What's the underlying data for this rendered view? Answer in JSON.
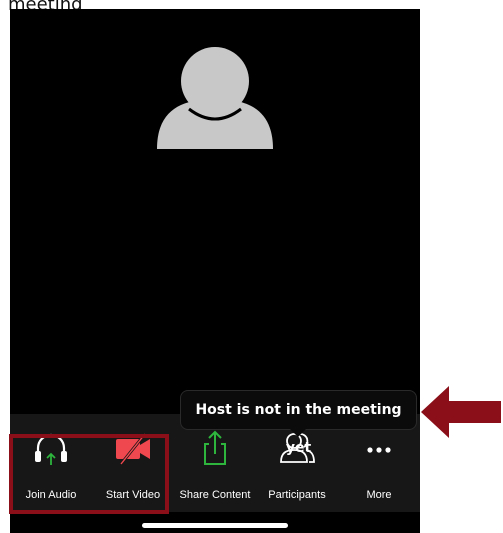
{
  "caption": "meeting",
  "tooltip": {
    "text": "Host is not in the meeting yet"
  },
  "toolbar": {
    "items": [
      {
        "label": "Join Audio",
        "icon": "headphones-icon"
      },
      {
        "label": "Start Video",
        "icon": "video-off-icon"
      },
      {
        "label": "Share Content",
        "icon": "share-icon"
      },
      {
        "label": "Participants",
        "icon": "participants-icon"
      },
      {
        "label": "More",
        "icon": "more-icon"
      }
    ]
  },
  "colors": {
    "screen_bg": "#000000",
    "toolbar_bg": "#171717",
    "accent_green": "#2db53d",
    "video_off_red": "#f0484f",
    "annotation_red": "#8a0f19",
    "avatar_gray": "#c8c8c8"
  }
}
